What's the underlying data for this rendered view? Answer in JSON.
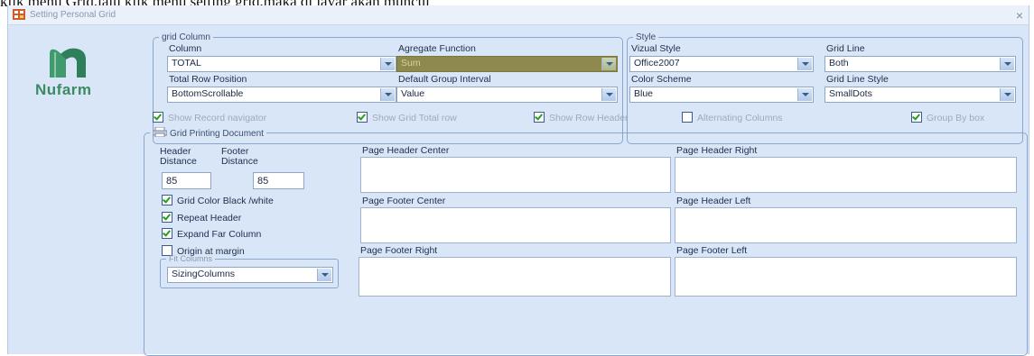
{
  "caption": "klik menu Grid,lalu klik menu setting grid,maka di layar akan muncul",
  "window": {
    "title": "Setting Personal Grid",
    "close_glyph": "×"
  },
  "logo": {
    "text": "Nufarm",
    "color": "#3b8a63"
  },
  "grid_column": {
    "legend": "grid Column",
    "column_label": "Column",
    "column_value": "TOTAL",
    "aggregate_label": "Agregate Function",
    "aggregate_value": "Sum",
    "total_row_label": "Total Row Position",
    "total_row_value": "BottomScrollable",
    "group_interval_label": "Default Group Interval",
    "group_interval_value": "Value"
  },
  "style": {
    "legend": "Style",
    "visual_style_label": "Vizual Style",
    "visual_style_value": "Office2007",
    "grid_line_label": "Grid Line",
    "grid_line_value": "Both",
    "color_scheme_label": "Color Scheme",
    "color_scheme_value": "Blue",
    "grid_line_style_label": "Grid Line Style",
    "grid_line_style_value": "SmallDots"
  },
  "options": [
    {
      "label": "Show Record navigator",
      "checked": true
    },
    {
      "label": "Show Grid Total row",
      "checked": true
    },
    {
      "label": "Show Row Header",
      "checked": true
    },
    {
      "label": "Alternating Columns",
      "checked": false
    },
    {
      "label": "Group By box",
      "checked": true
    }
  ],
  "printing": {
    "legend": "Grid Printing Document",
    "header_distance_label": "Header Distance",
    "header_distance_value": "85",
    "footer_distance_label": "Footer Distance",
    "footer_distance_value": "85",
    "checks": [
      {
        "label": "Grid Color Black /white",
        "checked": true
      },
      {
        "label": "Repeat Header",
        "checked": true
      },
      {
        "label": "Expand Far Column",
        "checked": true
      },
      {
        "label": "Origin at margin",
        "checked": false
      }
    ],
    "fit_columns_legend": "Fit Columns",
    "fit_columns_value": "SizingColumns",
    "page_header_center": "Page Header Center",
    "page_header_right": "Page Header Right",
    "page_footer_center": "Page Footer Center",
    "page_header_left": "Page Header Left",
    "page_footer_right": "Page Footer Right",
    "page_footer_left": "Page Footer Left"
  }
}
